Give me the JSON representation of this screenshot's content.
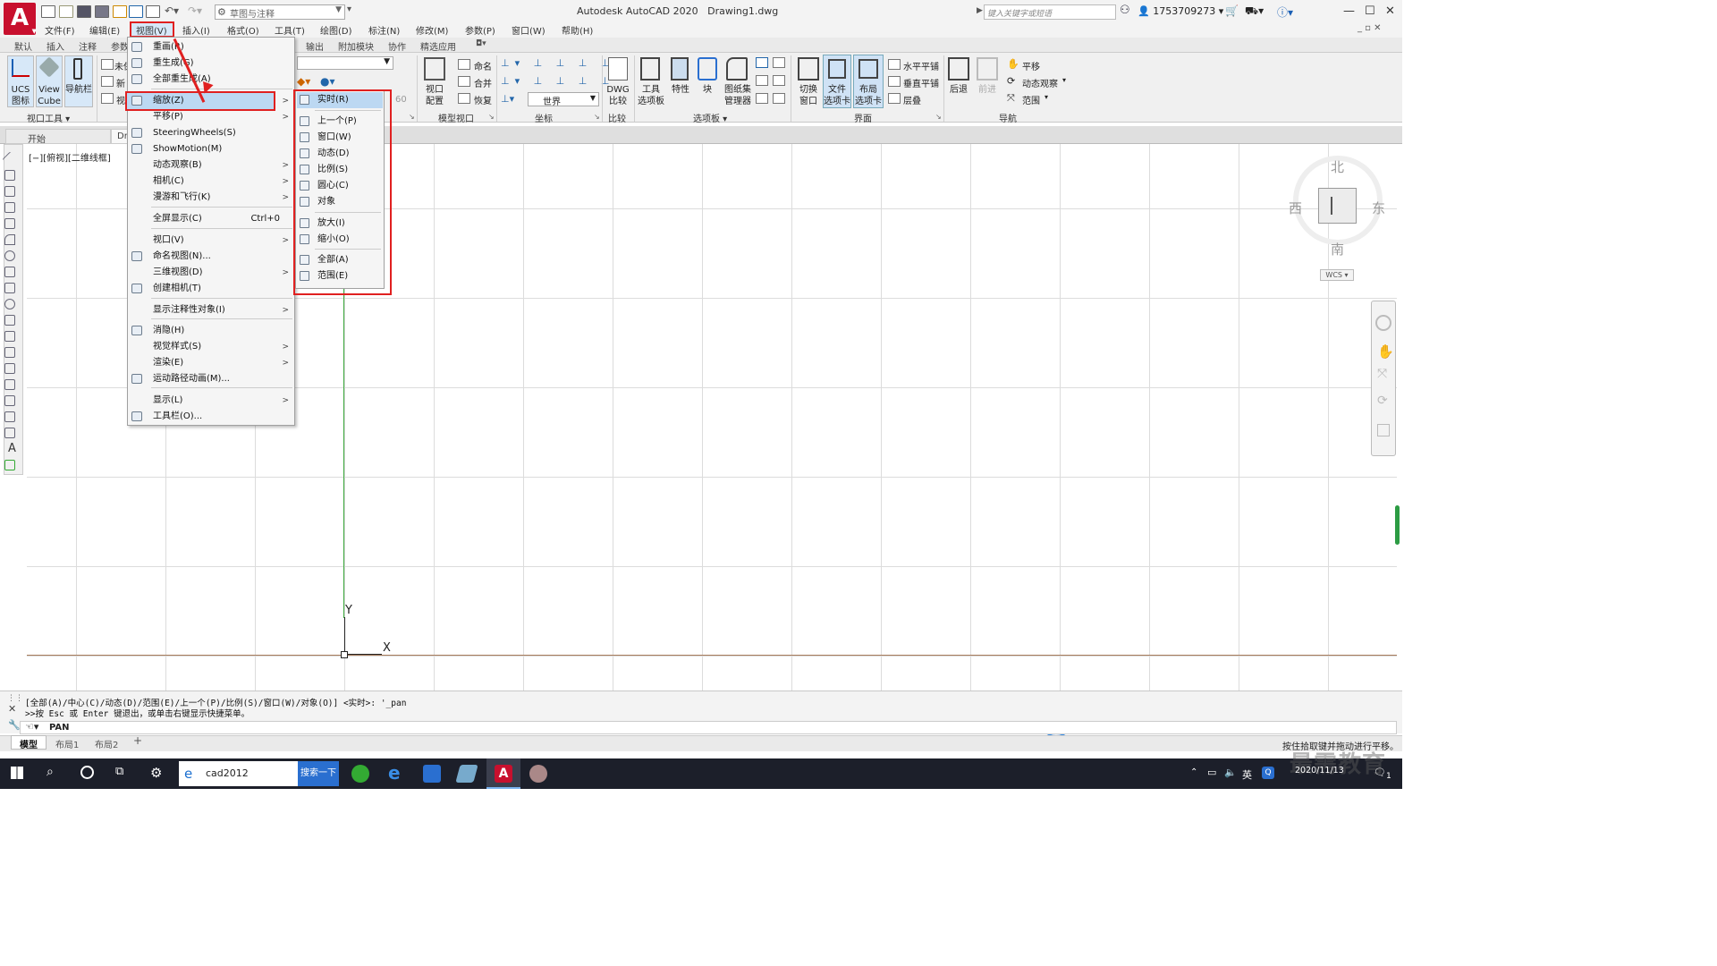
{
  "title_bar": {
    "app_title": "Autodesk AutoCAD 2020",
    "doc_title": "Drawing1.dwg",
    "workspace": "草图与注释",
    "search_placeholder": "键入关键字或短语",
    "username": "1753709273"
  },
  "menubar": [
    "文件(F)",
    "编辑(E)",
    "视图(V)",
    "插入(I)",
    "格式(O)",
    "工具(T)",
    "绘图(D)",
    "标注(N)",
    "修改(M)",
    "参数(P)",
    "窗口(W)",
    "帮助(H)"
  ],
  "ribbon_tabs": [
    "默认",
    "插入",
    "注释",
    "参数",
    "输出",
    "附加模块",
    "协作",
    "精选应用"
  ],
  "ribbon": {
    "ucs_label": "UCS\n图标",
    "viewcube_label": "View\nCube",
    "navbar_label": "导航栏",
    "panel_viewport_tools": "视口工具",
    "btn_unsaved": "未保",
    "btn_new": "新",
    "btn_view": "视",
    "viewport_config": "视口\n配置",
    "btn_name": "命名",
    "btn_join": "合并",
    "btn_restore": "恢复",
    "panel_model_viewports": "模型视口",
    "world": "世界",
    "panel_coords": "坐标",
    "dwg_compare": "DWG\n比较",
    "panel_compare": "比较",
    "tool_palettes": "工具\n选项板",
    "properties": "特性",
    "block": "块",
    "sheet_set": "图纸集\n管理器",
    "panel_palettes": "选项板",
    "switch_window": "切换\n窗口",
    "file_tabs": "文件\n选项卡",
    "layout_tabs": "布局\n选项卡",
    "tile_h": "水平平铺",
    "tile_v": "垂直平铺",
    "cascade": "层叠",
    "panel_interface": "界面",
    "back": "后退",
    "forward": "前进",
    "pan": "平移",
    "orbit": "动态观察",
    "extents": "范围",
    "panel_nav": "导航",
    "num60": "60"
  },
  "file_tabs": [
    "开始",
    "Dr"
  ],
  "view_label": "[−][俯视][二维线框]",
  "view_menu": {
    "items": [
      {
        "label": "重画(R)"
      },
      {
        "label": "重生成(G)"
      },
      {
        "label": "全部重生成(A)"
      },
      {
        "label": "缩放(Z)",
        "submenu": true
      },
      {
        "label": "平移(P)",
        "submenu": true
      },
      {
        "label": "SteeringWheels(S)"
      },
      {
        "label": "ShowMotion(M)"
      },
      {
        "label": "动态观察(B)",
        "submenu": true
      },
      {
        "label": "相机(C)",
        "submenu": true
      },
      {
        "label": "漫游和飞行(K)",
        "submenu": true
      },
      {
        "label": "全屏显示(C)",
        "shortcut": "Ctrl+0"
      },
      {
        "label": "视口(V)",
        "submenu": true
      },
      {
        "label": "命名视图(N)..."
      },
      {
        "label": "三维视图(D)",
        "submenu": true
      },
      {
        "label": "创建相机(T)"
      },
      {
        "label": "显示注释性对象(I)",
        "submenu": true
      },
      {
        "label": "消隐(H)"
      },
      {
        "label": "视觉样式(S)",
        "submenu": true
      },
      {
        "label": "渲染(E)",
        "submenu": true
      },
      {
        "label": "运动路径动画(M)..."
      },
      {
        "label": "显示(L)",
        "submenu": true
      },
      {
        "label": "工具栏(O)..."
      }
    ]
  },
  "zoom_menu": {
    "items": [
      "实时(R)",
      "上一个(P)",
      "窗口(W)",
      "动态(D)",
      "比例(S)",
      "圆心(C)",
      "对象",
      "放大(I)",
      "缩小(O)",
      "全部(A)",
      "范围(E)"
    ]
  },
  "viewcube": {
    "north": "北",
    "south": "南",
    "east": "东",
    "west": "西",
    "wcs": "WCS"
  },
  "ucs": {
    "y": "Y",
    "x": "X"
  },
  "command": {
    "line1": "[全部(A)/中心(C)/动态(D)/范围(E)/上一个(P)/比例(S)/窗口(W)/对象(O)] <实时>: '_pan",
    "line2": ">>按 Esc 或 Enter 键退出，或单击右键显示快捷菜单。",
    "prompt": "PAN"
  },
  "layout_tabs": [
    "模型",
    "布局1",
    "布局2",
    "+"
  ],
  "status_hint": "按住拾取键并拖动进行平移。",
  "taskbar": {
    "search_text": "cad2012",
    "search_button": "搜索一下",
    "ime": "英",
    "time": "",
    "date": "2020/11/13",
    "notif_count": "1"
  },
  "watermark": "最需教育",
  "colors": {
    "highlight_red": "#e02020",
    "menu_hl": "#bcd8f2",
    "taskbar": "#1c1f2a",
    "acad_red": "#c8102e"
  }
}
